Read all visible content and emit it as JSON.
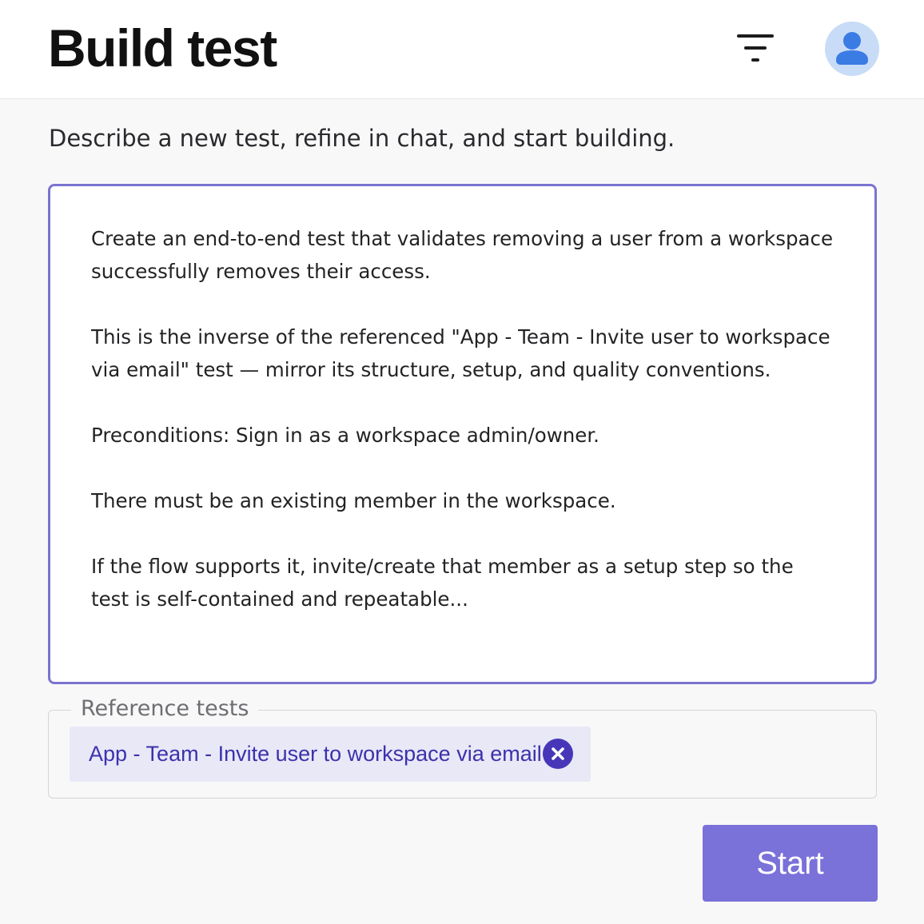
{
  "header": {
    "title": "Build test",
    "filter_icon": "filter-icon",
    "avatar_icon": "user-icon"
  },
  "main": {
    "subtitle": "Describe a new test, refine in chat, and start building.",
    "prompt": {
      "value": "Create an end-to-end test that validates removing a user from a workspace successfully removes their access.\n\nThis is the inverse of the referenced \"App - Team - Invite user to workspace via email\" test — mirror its structure, setup, and quality conventions.\n\nPreconditions: Sign in as a workspace admin/owner.\n\nThere must be an existing member in the workspace.\n\nIf the flow supports it, invite/create that member as a setup step so the test is self-contained and repeatable..."
    },
    "reference_tests": {
      "legend": "Reference tests",
      "chips": [
        {
          "label": "App - Team - Invite user to workspace via email",
          "remove_icon": "close-circle-icon"
        }
      ]
    },
    "start_label": "Start"
  },
  "colors": {
    "accent": "#7a71d9",
    "border_focus": "#7b74d0",
    "chip_bg": "#e9e8f7",
    "chip_text": "#3c31ad",
    "chip_remove": "#4737b8",
    "avatar_bg": "#c8dcf7",
    "avatar_fg": "#3b7be4"
  }
}
